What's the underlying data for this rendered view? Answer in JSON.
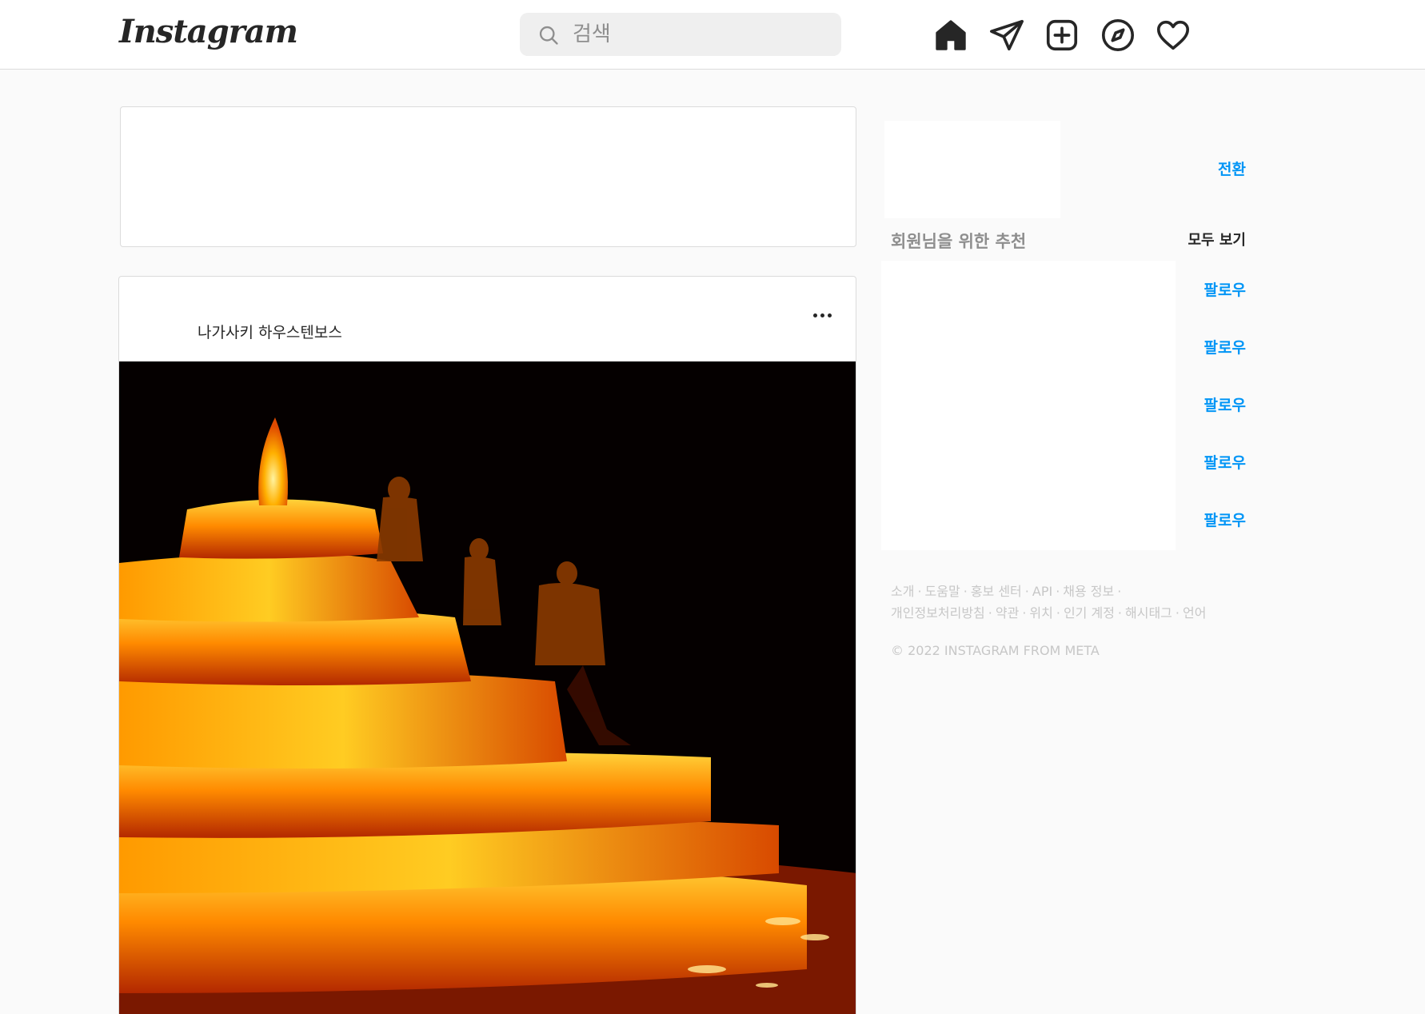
{
  "nav": {
    "logo": "Instagram",
    "search_placeholder": "검색"
  },
  "post": {
    "username": "나가사키 하우스텐보스"
  },
  "sidebar": {
    "switch_label": "전환",
    "suggestions_title": "회원님을 위한 추천",
    "see_all_label": "모두 보기",
    "follow_labels": [
      "팔로우",
      "팔로우",
      "팔로우",
      "팔로우",
      "팔로우"
    ]
  },
  "footer": {
    "row1": [
      "소개",
      "도움말",
      "홍보 센터",
      "API",
      "채용 정보",
      ""
    ],
    "row2": [
      "개인정보처리방침",
      "약관",
      "위치",
      "인기 계정",
      "해시태그",
      "언어"
    ],
    "copyright": "© 2022 INSTAGRAM FROM META"
  },
  "colors": {
    "accent_blue": "#0095f6",
    "border": "#dbdbdb",
    "bg": "#fafafa"
  }
}
